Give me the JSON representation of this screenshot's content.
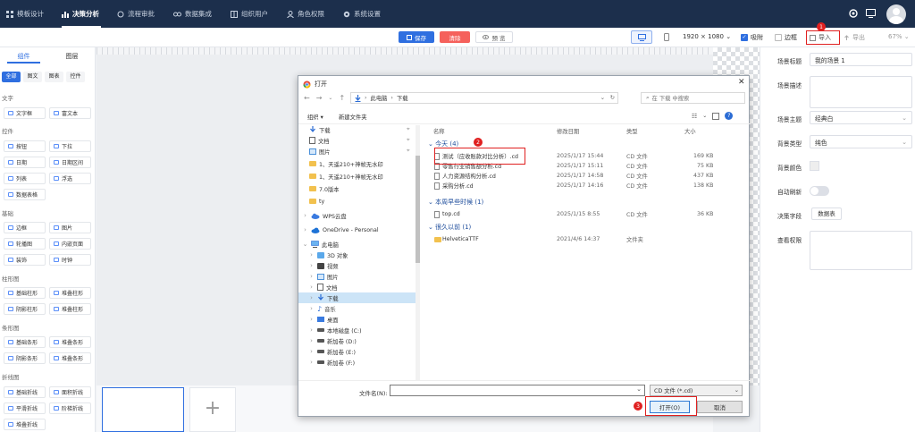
{
  "nav": {
    "items": [
      {
        "label": "模板设计",
        "icon": "grid-icon"
      },
      {
        "label": "决策分析",
        "icon": "bar-chart-icon"
      },
      {
        "label": "流程审批",
        "icon": "flow-icon"
      },
      {
        "label": "数据集成",
        "icon": "link-icon"
      },
      {
        "label": "组织用户",
        "icon": "org-icon"
      },
      {
        "label": "角色权限",
        "icon": "user-icon"
      },
      {
        "label": "系统设置",
        "icon": "gear-icon"
      }
    ]
  },
  "toolbar": {
    "save_label": "保存",
    "clear_label": "清除",
    "preview_label": "预 览",
    "resolution": "1920 × 1080",
    "snap_label": "吸附",
    "border_label": "边框",
    "import_label": "导入",
    "export_label": "导出",
    "zoom": "67%"
  },
  "left_panel": {
    "tabs": [
      "组件",
      "图层"
    ],
    "filters": [
      "全部",
      "图文",
      "图表",
      "控件"
    ],
    "sections": [
      {
        "title": "文字",
        "items": [
          "文字框",
          "富文本"
        ]
      },
      {
        "title": "控件",
        "items": [
          "按钮",
          "下拉",
          "日期",
          "日期区间",
          "列表",
          "浮选",
          "数据表格"
        ]
      },
      {
        "title": "基础",
        "items": [
          "边框",
          "图片",
          "轮播图",
          "内嵌页面",
          "装饰",
          "时钟"
        ]
      },
      {
        "title": "柱形图",
        "items": [
          "基础柱形",
          "堆叠柱形",
          "阴影柱形",
          "堆叠柱形"
        ]
      },
      {
        "title": "条形图",
        "items": [
          "基础条形",
          "堆叠条形",
          "阴影条形",
          "堆叠条形"
        ]
      },
      {
        "title": "折线图",
        "items": [
          "基础折线",
          "面积折线",
          "平滑折线",
          "阶梯折线",
          "堆叠折线"
        ]
      }
    ]
  },
  "right_panel": {
    "fields": [
      {
        "label": "场景标题",
        "value": "我的场景 1"
      },
      {
        "label": "场景描述",
        "value": ""
      },
      {
        "label": "场景主题",
        "value": "经典白"
      },
      {
        "label": "背景类型",
        "value": "纯色"
      },
      {
        "label": "背景颜色",
        "value": ""
      },
      {
        "label": "自动刷新",
        "value": ""
      },
      {
        "label": "决策字段",
        "value": "数据表"
      },
      {
        "label": "查看权限",
        "value": ""
      }
    ]
  },
  "dialog": {
    "title": "打开",
    "path": [
      "此电脑",
      "下载"
    ],
    "search_placeholder": "在 下载 中搜索",
    "organize": "组织 ▾",
    "new_folder": "新建文件夹",
    "columns": [
      "名称",
      "修改日期",
      "类型",
      "大小"
    ],
    "groups": [
      {
        "label": "今天 (4)",
        "files": [
          {
            "name": "测试（应收账款对比分析）.cd",
            "date": "2025/1/17 15:44",
            "type": "CD 文件",
            "size": "169 KB"
          },
          {
            "name": "零售行业销售额分析.cd",
            "date": "2025/1/17 15:11",
            "type": "CD 文件",
            "size": "75 KB"
          },
          {
            "name": "人力资源结构分析.cd",
            "date": "2025/1/17 14:58",
            "type": "CD 文件",
            "size": "437 KB"
          },
          {
            "name": "采购分析.cd",
            "date": "2025/1/17 14:16",
            "type": "CD 文件",
            "size": "138 KB"
          }
        ]
      },
      {
        "label": "本周早些时候 (1)",
        "files": [
          {
            "name": "top.cd",
            "date": "2025/1/15 8:55",
            "type": "CD 文件",
            "size": "36 KB"
          }
        ]
      },
      {
        "label": "很久以前 (1)",
        "files": [
          {
            "name": "HelveticaTTF",
            "date": "2021/4/6 14:37",
            "type": "文件夹",
            "size": ""
          }
        ]
      }
    ],
    "tree": [
      {
        "label": "下载",
        "kind": "download"
      },
      {
        "label": "文档",
        "kind": "doc"
      },
      {
        "label": "图片",
        "kind": "pic"
      },
      {
        "label": "1、天遥210+神帧无水印",
        "kind": "folder"
      },
      {
        "label": "1、天遥210+神帧无水印",
        "kind": "folder"
      },
      {
        "label": "7.0版本",
        "kind": "folder"
      },
      {
        "label": "ty",
        "kind": "folder"
      },
      {
        "label": "WPS云盘",
        "kind": "cloud"
      },
      {
        "label": "OneDrive - Personal",
        "kind": "cloud"
      },
      {
        "label": "此电脑",
        "kind": "pc"
      },
      {
        "label": "3D 对象",
        "kind": "obj"
      },
      {
        "label": "视频",
        "kind": "video"
      },
      {
        "label": "图片",
        "kind": "pic"
      },
      {
        "label": "文档",
        "kind": "doc"
      },
      {
        "label": "下载",
        "kind": "download"
      },
      {
        "label": "音乐",
        "kind": "music"
      },
      {
        "label": "桌面",
        "kind": "desk"
      },
      {
        "label": "本地磁盘 (C:)",
        "kind": "drive"
      },
      {
        "label": "新加卷 (D:)",
        "kind": "drive"
      },
      {
        "label": "新加卷 (E:)",
        "kind": "drive"
      },
      {
        "label": "新加卷 (F:)",
        "kind": "drive"
      }
    ],
    "filename_label": "文件名(N):",
    "filetype": "CD 文件 (*.cd)",
    "open_label": "打开(O)",
    "cancel_label": "取消"
  },
  "badges": [
    "1",
    "2",
    "3"
  ],
  "colors": {
    "nav_bg": "#1c2f4c",
    "primary": "#2f6fe0",
    "danger": "#f5615c",
    "highlight": "#e02020"
  }
}
